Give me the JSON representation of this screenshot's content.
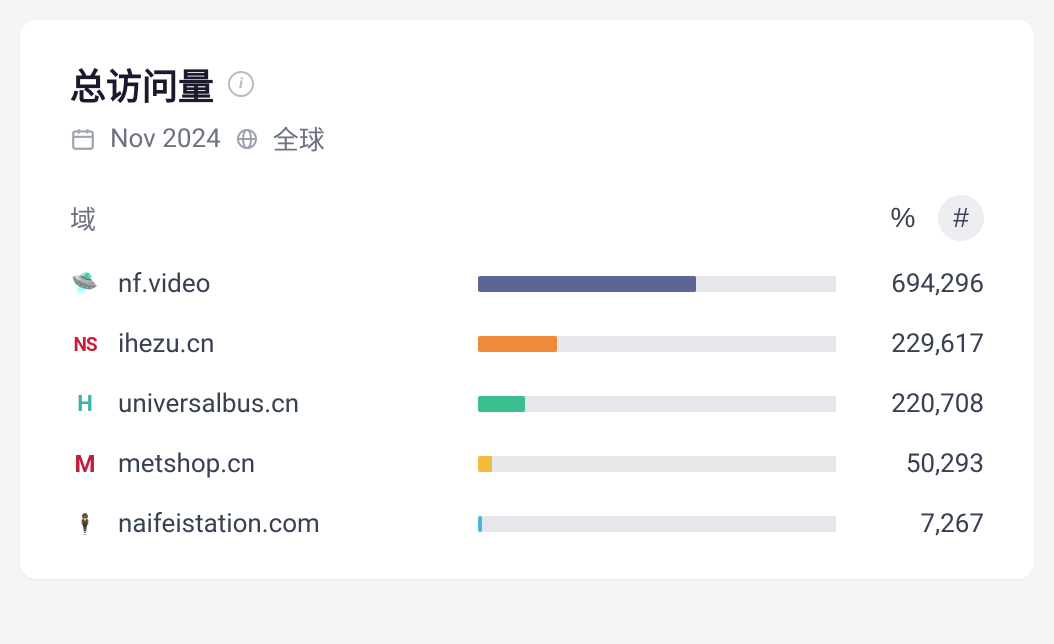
{
  "header": {
    "title": "总访问量",
    "date": "Nov 2024",
    "region": "全球"
  },
  "columns": {
    "domain_label": "域",
    "percent_symbol": "%",
    "count_symbol": "#"
  },
  "chart_data": {
    "type": "bar",
    "title": "总访问量",
    "xlabel": "",
    "ylabel": "域",
    "categories": [
      "nf.video",
      "ihezu.cn",
      "universalbus.cn",
      "metshop.cn",
      "naifeistation.com"
    ],
    "values": [
      694296,
      229617,
      220708,
      50293,
      7267
    ],
    "series": [
      {
        "name": "nf.video",
        "value": 694296,
        "value_display": "694,296",
        "color": "#5d6596",
        "icon_class": "favicon-nf",
        "icon_glyph": "🛸",
        "bar_pct": 61
      },
      {
        "name": "ihezu.cn",
        "value": 229617,
        "value_display": "229,617",
        "color": "#ef8a3a",
        "icon_class": "favicon-ns",
        "icon_glyph": "NS",
        "bar_pct": 22
      },
      {
        "name": "universalbus.cn",
        "value": 220708,
        "value_display": "220,708",
        "color": "#3bbf8f",
        "icon_class": "favicon-h",
        "icon_glyph": "H",
        "bar_pct": 13
      },
      {
        "name": "metshop.cn",
        "value": 50293,
        "value_display": "50,293",
        "color": "#f5b93e",
        "icon_class": "favicon-m",
        "icon_glyph": "M",
        "bar_pct": 4
      },
      {
        "name": "naifeistation.com",
        "value": 7267,
        "value_display": "7,267",
        "color": "#4db6d8",
        "icon_class": "favicon-naifei",
        "icon_glyph": "🕴",
        "bar_pct": 1
      }
    ]
  }
}
